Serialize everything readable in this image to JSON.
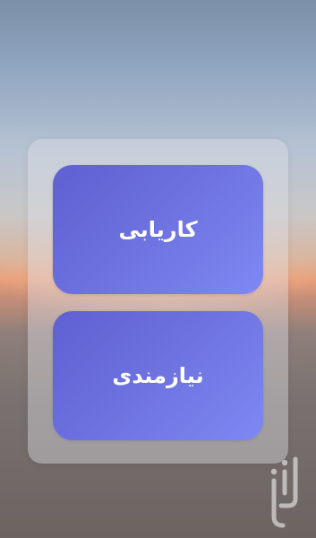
{
  "buttons": [
    {
      "label": "کاریابی"
    },
    {
      "label": "نیازمندی"
    }
  ],
  "watermark": {
    "text": "بازار",
    "icon": "bazaar-logo"
  },
  "colors": {
    "card_start": "#5f5fd2",
    "card_end": "#7e88f3",
    "label": "#ffffff"
  }
}
